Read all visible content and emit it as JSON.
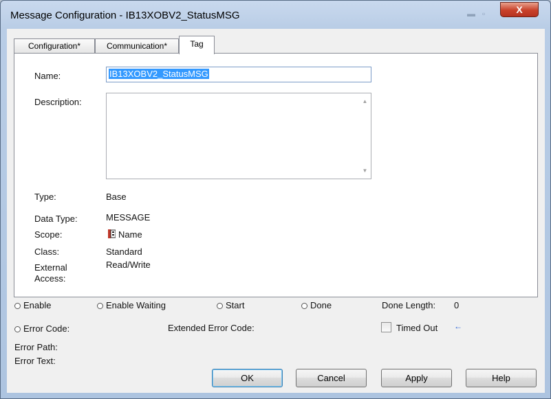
{
  "window": {
    "title": "Message Configuration - IB13XOBV2_StatusMSG",
    "close_label": "X",
    "minimize_glyph": "▬",
    "maximize_glyph": "▫"
  },
  "tabs": [
    {
      "label": "Configuration*",
      "active": false
    },
    {
      "label": "Communication*",
      "active": false
    },
    {
      "label": "Tag",
      "active": true
    }
  ],
  "tag": {
    "name_label": "Name:",
    "name_value": "IB13XOBV2_StatusMSG",
    "description_label": "Description:",
    "description_value": "",
    "type_label": "Type:",
    "type_value": "Base",
    "data_type_label": "Data Type:",
    "data_type_value": "MESSAGE",
    "scope_label": "Scope:",
    "scope_icon": "controller-tag-icon",
    "scope_value": "Name",
    "class_label": "Class:",
    "class_value": "Standard",
    "external_access_label_1": "External",
    "external_access_label_2": "Access:",
    "external_access_value": "Read/Write"
  },
  "status": {
    "enable": "Enable",
    "enable_waiting": "Enable Waiting",
    "start": "Start",
    "done": "Done",
    "done_length_label": "Done Length:",
    "done_length_value": "0",
    "error_code": "Error Code:",
    "extended_error_code": "Extended Error Code:",
    "timed_out": "Timed Out",
    "timed_out_checked": false,
    "arrow_glyph": "←",
    "error_path": "Error Path:",
    "error_text": "Error Text:"
  },
  "buttons": {
    "ok": "OK",
    "cancel": "Cancel",
    "apply": "Apply",
    "help": "Help"
  },
  "colors": {
    "selection": "#3399ff",
    "close_button": "#c8412a",
    "title_bar": "#c9d9ee"
  }
}
